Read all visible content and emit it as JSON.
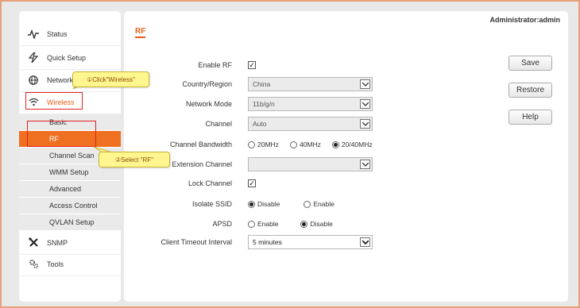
{
  "header": {
    "user_label": "Administrator:admin"
  },
  "page": {
    "title": "RF"
  },
  "sidebar": {
    "items": [
      {
        "label": "Status",
        "icon": "pulse-icon"
      },
      {
        "label": "Quick Setup",
        "icon": "bolt-icon"
      },
      {
        "label": "Network",
        "icon": "globe-icon"
      },
      {
        "label": "Wireless",
        "icon": "wifi-icon"
      },
      {
        "label": "SNMP",
        "icon": "tools-cross-icon"
      },
      {
        "label": "Tools",
        "icon": "gears-icon"
      }
    ],
    "submenu": [
      {
        "label": "Basic"
      },
      {
        "label": "RF"
      },
      {
        "label": "Channel Scan"
      },
      {
        "label": "WMM Setup"
      },
      {
        "label": "Advanced"
      },
      {
        "label": "Access Control"
      },
      {
        "label": "QVLAN Setup"
      }
    ]
  },
  "form": {
    "enable_rf": {
      "label": "Enable RF",
      "checked": true
    },
    "country": {
      "label": "Country/Region",
      "value": "China"
    },
    "network_mode": {
      "label": "Network Mode",
      "value": "11b/g/n"
    },
    "channel": {
      "label": "Channel",
      "value": "Auto"
    },
    "bandwidth": {
      "label": "Channel Bandwidth",
      "options": [
        "20MHz",
        "40MHz",
        "20/40MHz"
      ],
      "selected": "20/40MHz"
    },
    "ext_channel": {
      "label": "Extension Channel",
      "value": ""
    },
    "lock_channel": {
      "label": "Lock Channel",
      "checked": true
    },
    "isolate_ssid": {
      "label": "Isolate SSID",
      "options": [
        "Disable",
        "Enable"
      ],
      "selected": "Disable"
    },
    "apsd": {
      "label": "APSD",
      "options": [
        "Enable",
        "Disable"
      ],
      "selected": "Disable"
    },
    "client_timeout": {
      "label": "Client Timeout Interval",
      "value": "5 minutes"
    }
  },
  "buttons": {
    "save": "Save",
    "restore": "Restore",
    "help": "Help"
  },
  "annotations": {
    "callout_1": "①Click\"Wireless\"",
    "callout_2": "②Select \"RF\""
  },
  "colors": {
    "accent": "#e8611b",
    "selected_bg": "#f07021",
    "callout_bg": "#fff68f",
    "highlight_box": "#e02020"
  }
}
